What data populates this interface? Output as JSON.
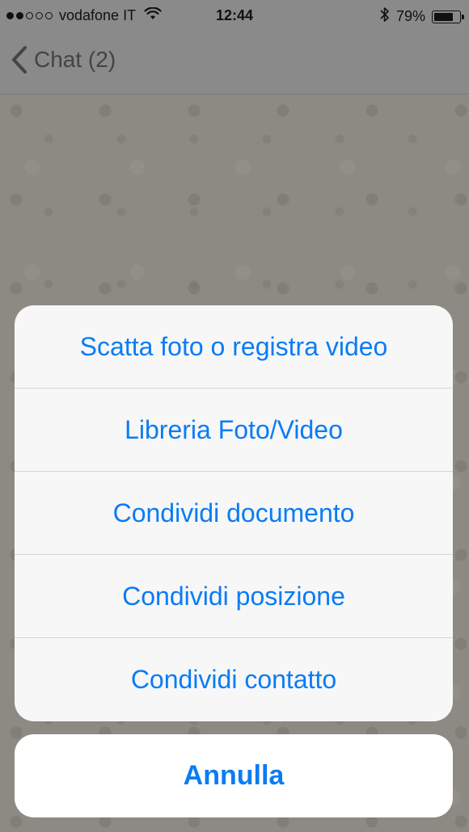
{
  "status_bar": {
    "carrier": "vodafone IT",
    "signal_bars_filled": 2,
    "signal_bars_total": 5,
    "time": "12:44",
    "battery_percent": "79%",
    "battery_level": 0.79
  },
  "nav": {
    "back_label": "Chat (2)"
  },
  "action_sheet": {
    "items": [
      {
        "label": "Scatta foto o registra video"
      },
      {
        "label": "Libreria Foto/Video"
      },
      {
        "label": "Condividi documento"
      },
      {
        "label": "Condividi posizione"
      },
      {
        "label": "Condividi contatto"
      }
    ],
    "cancel_label": "Annulla"
  },
  "colors": {
    "accent": "#0a7cf5",
    "overlay": "#8a8983"
  },
  "icons": [
    "wifi-icon",
    "bluetooth-icon",
    "battery-icon",
    "chevron-left-icon"
  ]
}
